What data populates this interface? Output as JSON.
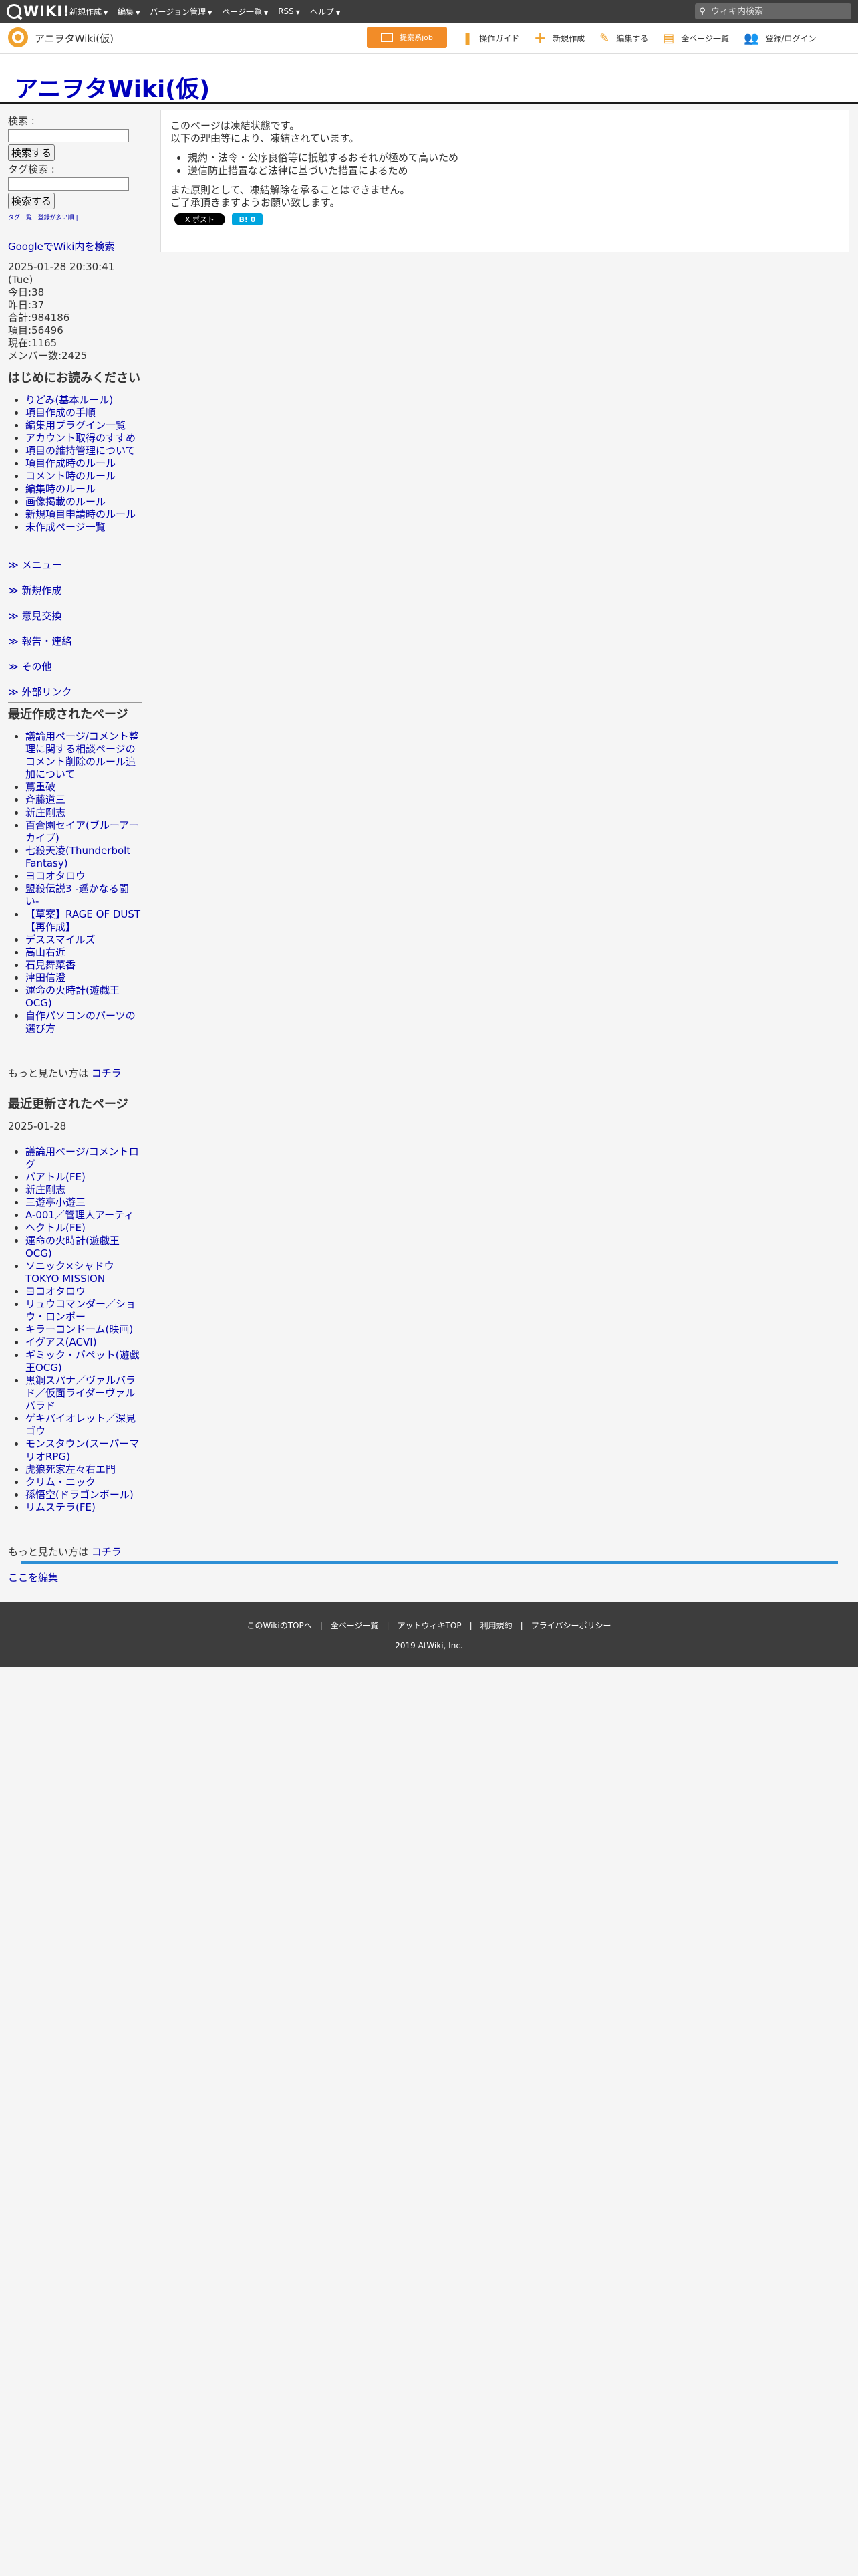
{
  "topbar": {
    "logo_text": "WIKI",
    "menu": [
      "新規作成",
      "編集",
      "バージョン管理",
      "ページ一覧",
      "RSS",
      "ヘルプ"
    ],
    "search_placeholder": "ウィキ内検索"
  },
  "subbar": {
    "site_name": "アニヲタWiki(仮)",
    "pr_label": "提案系job",
    "tools": [
      "操作ガイド",
      "新規作成",
      "編集する",
      "全ページ一覧",
      "登録/ログイン"
    ]
  },
  "header": {
    "title": "アニヲタWiki(仮)"
  },
  "sidebar": {
    "search_label": "検索 :",
    "tag_search_label": "タグ検索 :",
    "search_button": "検索する",
    "tag_search_button": "検索する",
    "tag_links": "タグ一覧 | 登録が多い順 |",
    "google_search": "GoogleでWiki内を検索",
    "stats": [
      "2025-01-28 20:30:41 (Tue)",
      "今日:38",
      "昨日:37",
      "合計:984186",
      "項目:56496",
      "現在:1165",
      "メンバー数:2425"
    ],
    "intro_heading": "はじめにお読みください",
    "intro_items": [
      "りどみ(基本ルール)",
      "項目作成の手順",
      "編集用プラグイン一覧",
      "アカウント取得のすすめ",
      "項目の維持管理について",
      "項目作成時のルール",
      "コメント時のルール",
      "編集時のルール",
      "画像掲載のルール",
      "新規項目申請時のルール",
      "未作成ページ一覧"
    ],
    "menu_heads": [
      "≫ メニュー",
      "≫ 新規作成",
      "≫ 意見交換",
      "≫ 報告・連絡",
      "≫ その他",
      "≫ 外部リンク"
    ],
    "recent_created_heading": "最近作成されたページ",
    "recent_created": [
      "議論用ページ/コメント整理に関する相談ページのコメント削除のルール追加について",
      "蔦重破",
      "斉藤道三",
      "新庄剛志",
      "百合園セイア(ブルーアーカイブ)",
      "七殺天凌(Thunderbolt Fantasy)",
      "ヨコオタロウ",
      "盟殺伝説3 -遥かなる闘い-",
      "【草案】RAGE OF DUST【再作成】",
      "デススマイルズ",
      "高山右近",
      "石見舞菜香",
      "津田信澄",
      "運命の火時計(遊戯王OCG)",
      "自作パソコンのパーツの選び方"
    ],
    "more_text": "もっと見たい方は",
    "more_link": "コチラ",
    "recent_updated_heading": "最近更新されたページ",
    "updated_date": "2025-01-28",
    "recent_updated": [
      "議論用ページ/コメントログ",
      "バアトル(FE)",
      "新庄剛志",
      "三遊亭小遊三",
      "A-001／管理人アーティ",
      "ヘクトル(FE)",
      "運命の火時計(遊戯王OCG)",
      "ソニック×シャドウ TOKYO MISSION",
      "ヨコオタロウ",
      "リュウコマンダー／ショウ・ロンポー",
      "キラーコンドーム(映画)",
      "イグアス(ACVI)",
      "ギミック・パペット(遊戯王OCG)",
      "黒鋼スパナ／ヴァルバラド／仮面ライダーヴァルバラド",
      "ゲキバイオレット／深見ゴウ",
      "モンスタウン(スーパーマリオRPG)",
      "虎狼死家左々右エ門",
      "クリム・ニック",
      "孫悟空(ドラゴンボール)",
      "リムステラ(FE)"
    ],
    "more_text2": "もっと見たい方は",
    "more_link2": "コチラ",
    "edit_here": "ここを編集"
  },
  "content": {
    "line1": "このページは凍結状態です。",
    "line2": "以下の理由等により、凍結されています。",
    "reasons": [
      "規約・法令・公序良俗等に抵触するおそれが極めて高いため",
      "送信防止措置など法律に基づいた措置によるため"
    ],
    "line3": "また原則として、凍結解除を承ることはできません。",
    "line4": "ご了承頂きますようお願い致します。",
    "x_post": "X ポスト",
    "hatena": "B! 0"
  },
  "footer": {
    "links": [
      "このWikiのTOPへ",
      "全ページ一覧",
      "アットウィキTOP",
      "利用規約",
      "プライバシーポリシー"
    ],
    "copyright": "2019 AtWiki, Inc."
  }
}
